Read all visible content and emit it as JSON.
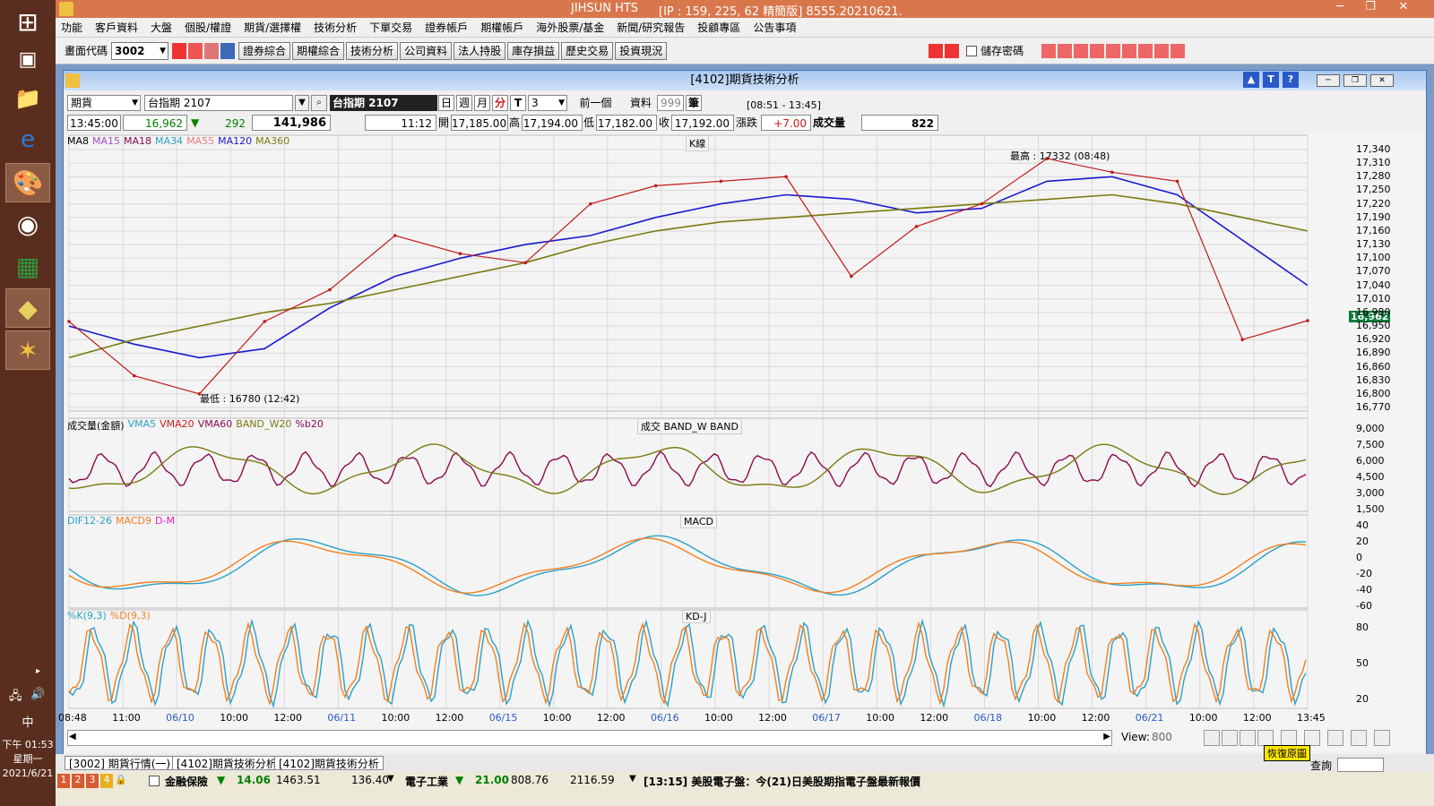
{
  "window": {
    "app_name": "JIHSUN HTS",
    "server_info": "[IP : 159, 225, 62 精簡版] 8555.20210621."
  },
  "taskbar": {
    "clock_time": "下午 01:53",
    "clock_weekday": "星期一",
    "clock_date": "2021/6/21",
    "ime": "中"
  },
  "menu": [
    "功能",
    "客戶資料",
    "大盤",
    "個股/權證",
    "期貨/選擇權",
    "技術分析",
    "下單交易",
    "證券帳戶",
    "期權帳戶",
    "海外股票/基金",
    "新聞/研究報告",
    "投顧專區",
    "公告事項"
  ],
  "toolbar": {
    "screen_code_label": "畫面代碼",
    "screen_code_value": "3002",
    "buttons": [
      "證券綜合",
      "期權綜合",
      "技術分析",
      "公司資料",
      "法人持股",
      "庫存損益",
      "歷史交易",
      "投資現況"
    ],
    "save_password": "儲存密碼"
  },
  "child_window": {
    "title": "[4102]期貨技術分析",
    "product_type": "期貨",
    "contract": "台指期 2107",
    "contract_display": "台指期 2107",
    "period_buttons": [
      "日",
      "週",
      "月",
      "分",
      "T"
    ],
    "period_value": "3",
    "prev_button": "前一個",
    "data_label": "資料",
    "data_count": "999",
    "data_unit": "筆",
    "session": "[08:51 - 13:45]"
  },
  "quote": {
    "time": "13:45:00",
    "price": "16,962",
    "change_arrow": "▼",
    "change": "292",
    "volume_total": "141,986",
    "bar_time": "11:12",
    "open_label": "開",
    "open": "17,185.00",
    "high_label": "高",
    "high": "17,194.00",
    "low_label": "低",
    "low": "17,182.00",
    "close_label": "收",
    "close": "17,192.00",
    "chg_label": "漲跌",
    "chg": "+7.00",
    "vol_label": "成交量",
    "vol": "822"
  },
  "panels": {
    "kline": {
      "title": "K線",
      "legend": [
        {
          "name": "MA8",
          "color": "#000000"
        },
        {
          "name": "MA15",
          "color": "#a64dc9"
        },
        {
          "name": "MA18",
          "color": "#8b0a50"
        },
        {
          "name": "MA34",
          "color": "#2aa0c8"
        },
        {
          "name": "MA55",
          "color": "#f07a7a"
        },
        {
          "name": "MA120",
          "color": "#1a1ad0"
        },
        {
          "name": "MA360",
          "color": "#7a7a10"
        }
      ],
      "high_note": "最高 : 17332 (08:48)",
      "low_note": "最低 : 16780 (12:42)",
      "last_price_tag": "16,962"
    },
    "volume": {
      "title_left": "成交量(金額)",
      "legend": [
        {
          "name": "VMA5",
          "color": "#2aa0c8"
        },
        {
          "name": "VMA20",
          "color": "#d01a1a"
        },
        {
          "name": "VMA60",
          "color": "#8b0a50"
        },
        {
          "name": "BAND_W20",
          "color": "#7a7a10"
        },
        {
          "name": "%b20",
          "color": "#8b0a50"
        }
      ],
      "center_label": "成交 BAND_W BAND"
    },
    "macd": {
      "title": "MACD",
      "legend": [
        {
          "name": "DIF12-26",
          "color": "#2aa0c8"
        },
        {
          "name": "MACD9",
          "color": "#f08020"
        },
        {
          "name": "D-M",
          "color": "#e020c0"
        }
      ]
    },
    "kd": {
      "title": "KD-J",
      "legend": [
        {
          "name": "%K(9,3)",
          "color": "#2aa0c8"
        },
        {
          "name": "%D(9,3)",
          "color": "#f08020"
        }
      ]
    }
  },
  "chart_data": {
    "type": "line",
    "series": [
      {
        "name": "MA120",
        "values": [
          16950,
          16910,
          16880,
          16900,
          16990,
          17060,
          17100,
          17130,
          17150,
          17190,
          17220,
          17240,
          17230,
          17200,
          17210,
          17270,
          17280,
          17240,
          17140,
          17040
        ]
      },
      {
        "name": "MA360",
        "values": [
          16880,
          16920,
          16950,
          16980,
          17000,
          17030,
          17060,
          17090,
          17130,
          17160,
          17180,
          17190,
          17200,
          17210,
          17220,
          17230,
          17240,
          17220,
          17190,
          17160
        ]
      },
      {
        "name": "Close",
        "values": [
          16960,
          16840,
          16800,
          16960,
          17030,
          17150,
          17110,
          17090,
          17220,
          17260,
          17270,
          17280,
          17060,
          17170,
          17220,
          17320,
          17290,
          17270,
          16920,
          16962
        ]
      }
    ],
    "ylim": [
      16770,
      17340
    ],
    "y_ticks": [
      "17,340",
      "17,310",
      "17,280",
      "17,250",
      "17,220",
      "17,190",
      "17,160",
      "17,130",
      "17,100",
      "17,070",
      "17,040",
      "17,010",
      "16,980",
      "16,950",
      "16,920",
      "16,890",
      "16,860",
      "16,830",
      "16,800",
      "16,770"
    ],
    "volume_ticks": [
      "9,000",
      "7,500",
      "6,000",
      "4,500",
      "3,000",
      "1,500"
    ],
    "macd_ticks": [
      "40",
      "20",
      "0",
      "-20",
      "-40",
      "-60"
    ],
    "kd_ticks": [
      "80",
      "50",
      "20"
    ],
    "x_labels": [
      "08:48",
      "11:00",
      "06/10",
      "10:00",
      "12:00",
      "06/11",
      "10:00",
      "12:00",
      "06/15",
      "10:00",
      "12:00",
      "06/16",
      "10:00",
      "12:00",
      "06/17",
      "10:00",
      "12:00",
      "06/18",
      "10:00",
      "12:00",
      "06/21",
      "10:00",
      "12:00",
      "13:45"
    ]
  },
  "view": {
    "label": "View:",
    "value": "800",
    "restore_tip": "恢復原圖"
  },
  "tabs": [
    "[3002] 期貨行情(一)",
    "[4102]期貨技術分析",
    "[4102]期貨技術分析"
  ],
  "ticker": {
    "nums": [
      "1",
      "2",
      "3",
      "4"
    ],
    "item1_name": "金融保險",
    "item1_arrow": "▼",
    "item1_chg": "14.06",
    "item1_idx": "1463.51",
    "item1_vol": "136.40",
    "item2_name": "電子工業",
    "item2_arrow": "▼",
    "item2_chg": "21.00",
    "item2_idx": "808.76",
    "item2_vol": "2116.59",
    "news": "[13:15] 美股電子盤：今(21)日美股期指電子盤最新報價",
    "query": "查詢"
  },
  "colors": {
    "titlebar": "#d9774c",
    "up": "#d01a1a",
    "down": "#008000",
    "taskbar": "#5a2e1e"
  }
}
